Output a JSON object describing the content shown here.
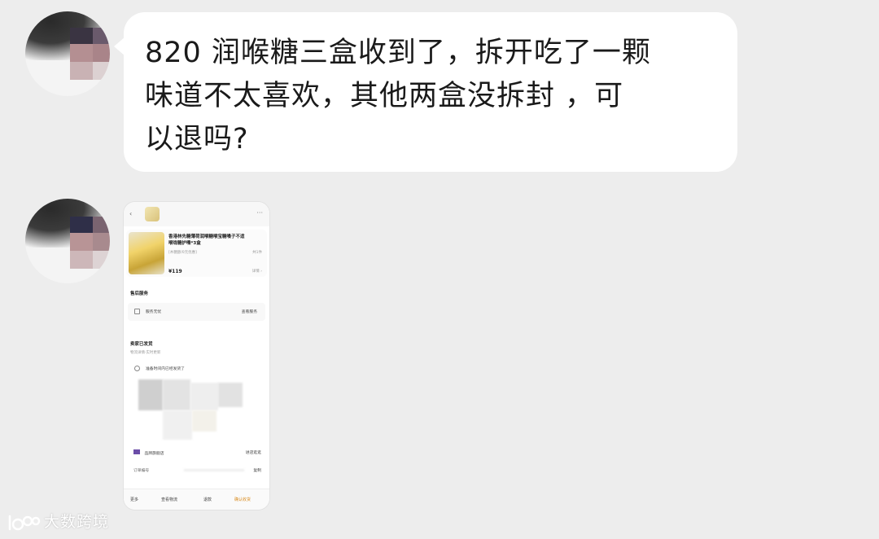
{
  "chat": {
    "message_text": "820 润喉糖三盒收到了，拆开吃了一颗\n味道不太喜欢，其他两盒没拆封 ，可\n以退吗?"
  },
  "screenshot": {
    "product_title": "香港林先糖薄荷润喉糖喉宝糖嗓子不适喉咙糖护嗓*3盒",
    "spec": "[木糖醇/0元优惠]",
    "qty": "共1件",
    "price": "¥119",
    "detail": "详情 ›",
    "section_service": "售后服务",
    "service_row_label": "服务无忧",
    "service_row_action": "查看服务",
    "section_shipping": "卖家已发货",
    "shipping_sub": "物流详情·实时更新",
    "address_row": "准备时间内已经发货了",
    "store_row": "品牌旗舰店",
    "store_action": "进店逛逛",
    "order_label": "订单编号",
    "order_action": "复制",
    "bb_more": "更多",
    "bb_logistics": "查看物流",
    "bb_refund": "退款",
    "bb_confirm": "确认收货"
  },
  "watermark": {
    "text": "大数跨境"
  },
  "colors": {
    "page_bg": "#ededed",
    "bubble_bg": "#ffffff",
    "accent_orange": "#d98b1e"
  }
}
